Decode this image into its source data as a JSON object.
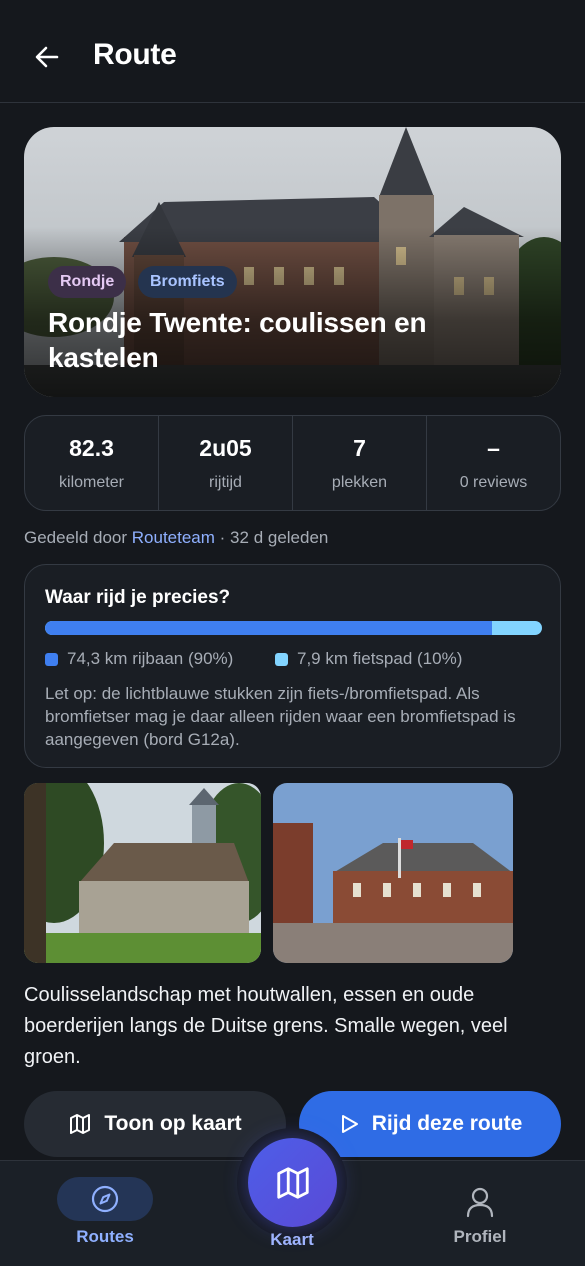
{
  "header": {
    "title": "Route",
    "back_icon": "arrow-left-icon"
  },
  "hero": {
    "tags": [
      "Rondje",
      "Bromfiets"
    ],
    "title": "Rondje Twente: coulissen en kastelen"
  },
  "stats": [
    {
      "value": "82.3",
      "label": "kilometer"
    },
    {
      "value": "2u05",
      "label": "rijtijd"
    },
    {
      "value": "7",
      "label": "plekken"
    },
    {
      "value": "–",
      "label": "0 reviews"
    }
  ],
  "shared": {
    "prefix": "Gedeeld door",
    "author": "Routeteam",
    "suffix": "· 32 d geleden"
  },
  "surface": {
    "question": "Waar rijd je precies?",
    "road_fraction": 0.9,
    "road_label": "74,3 km rijbaan (90%)",
    "path_label": "7,9 km fietspad (10%)",
    "road_color": "#3f7ff0",
    "path_color": "#82d4ff",
    "note": "Let op: de lichtblauwe stukken zijn fiets-/bromfietspad. Als bromfietser mag je daar alleen rijden waar een bromfietspad is aangegeven (bord G12a)."
  },
  "description": "Coulisselandschap met houtwallen, essen en oude boerderijen langs de Duitse grens. Smalle wegen, veel groen.",
  "actions": {
    "map_label": "Toon op kaart",
    "map_icon": "map-icon",
    "ride_label": "Rijd deze route",
    "ride_icon": "play-icon"
  },
  "nav": {
    "routes_label": "Routes",
    "map_label": "Kaart",
    "profile_label": "Profiel"
  }
}
